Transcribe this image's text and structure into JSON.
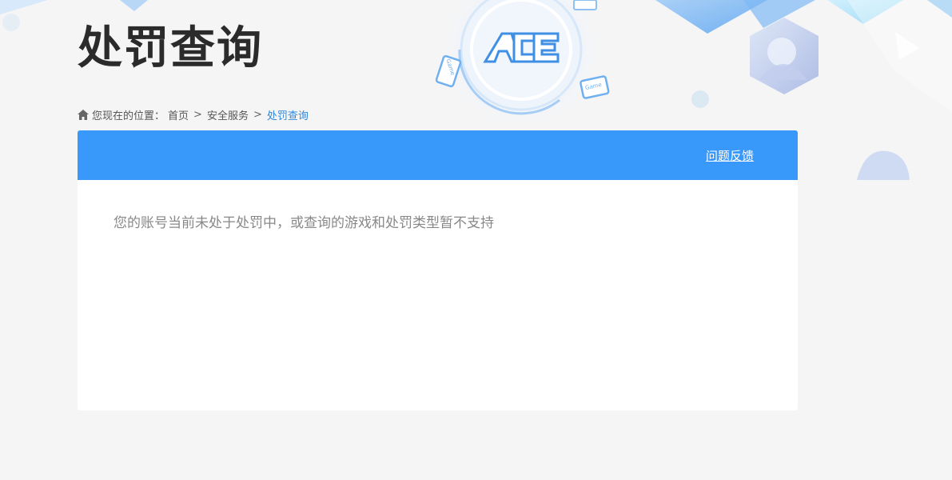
{
  "page": {
    "title": "处罚查询"
  },
  "breadcrumb": {
    "prefix": "您现在的位置：",
    "items": [
      "首页",
      "安全服务",
      "处罚查询"
    ],
    "separator": ">"
  },
  "panel": {
    "feedback_label": "问题反馈",
    "message": "您的账号当前未处于处罚中，或查询的游戏和处罚类型暂不支持"
  },
  "decor": {
    "logo_text": "ACE",
    "device_labels": [
      "Game",
      "Game"
    ]
  },
  "colors": {
    "header_blue": "#3899fa",
    "link_blue": "#2f88d8",
    "title": "#2b2b2b"
  },
  "icons": {
    "breadcrumb": "home-icon"
  }
}
